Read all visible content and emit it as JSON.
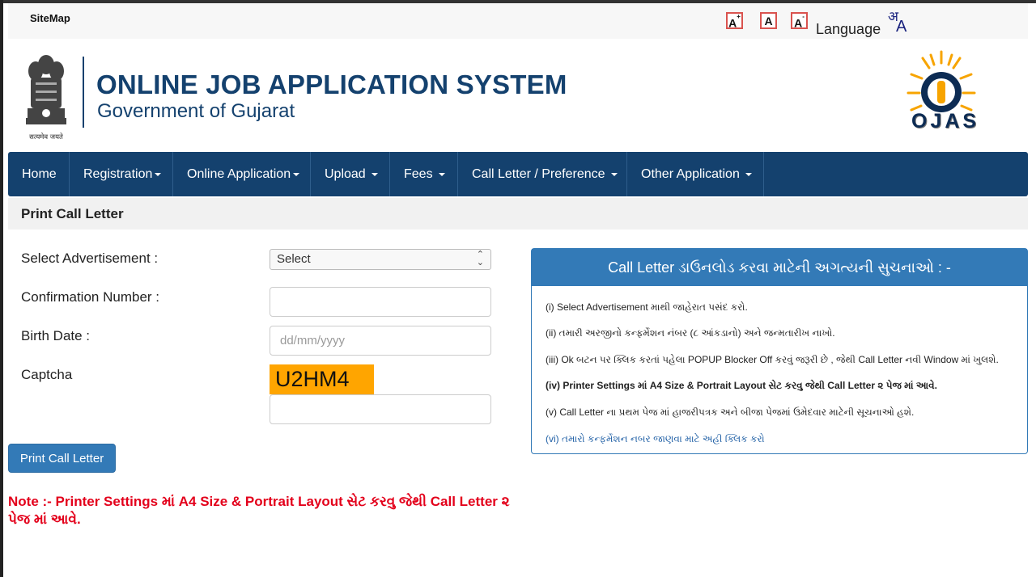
{
  "topbar": {
    "sitemap": "SiteMap",
    "font_increase": "A",
    "font_increase_sup": "+",
    "font_normal": "A",
    "font_decrease": "A",
    "font_decrease_sup": "-",
    "language": "Language",
    "language_icon_deva": "अ",
    "language_icon_latin": "A"
  },
  "header": {
    "emblem_caption": "सत्यमेव जयते",
    "title": "ONLINE JOB APPLICATION SYSTEM",
    "subtitle": "Government of Gujarat",
    "logo_text": "OJAS"
  },
  "nav": {
    "items": [
      {
        "label": "Home",
        "dropdown": false
      },
      {
        "label": "Registration",
        "dropdown": true
      },
      {
        "label": "Online Application",
        "dropdown": true
      },
      {
        "label": "Upload",
        "dropdown": true
      },
      {
        "label": "Fees",
        "dropdown": true
      },
      {
        "label": "Call Letter / Preference",
        "dropdown": true
      },
      {
        "label": "Other Application",
        "dropdown": true
      }
    ]
  },
  "page": {
    "title": "Print Call Letter"
  },
  "form": {
    "advertisement_label": "Select Advertisement :",
    "advertisement_value": "Select",
    "confirmation_label": "Confirmation Number :",
    "confirmation_value": "",
    "birthdate_label": "Birth Date :",
    "birthdate_placeholder": "dd/mm/yyyy",
    "captcha_label": "Captcha",
    "captcha_text": "U2HM4",
    "captcha_value": "",
    "submit_label": "Print Call Letter"
  },
  "note": "Note :- Printer Settings માં A4 Size & Portrait Layout સેટ કરવુ જેથી Call Letter ૨ પેજ માં આવે.",
  "instructions": {
    "title": "Call Letter ડાઉનલોડ કરવા માટેની અગત્યની સુચનાઓ : -",
    "items": [
      "(i) Select Advertisement માથી જાહેરાત પસંદ કરો.",
      "(ii) તમારી અરજીનો કન્ફર્મેશન નંબર (૮ આંકડાનો) અને જન્મતારીખ નાખો.",
      "(iii) Ok બટન પર ક્લિક કરતાં પહેલા POPUP Blocker Off કરવું જરૂરી છે , જેથી Call Letter નવી Window માં ખુલશે.",
      "(iv) Printer Settings માં A4 Size & Portrait Layout સેટ કરવુ જેથી Call Letter ૨ પેજ માં આવે.",
      "(v) Call Letter ના પ્રથમ પેજ માં હાજરીપત્રક અને બીજા પેજમાં ઉમેદવાર માટેની સૂચનાઓ હશે.",
      "(vi) તમારો કન્ફર્મેશન નબર જાણવા માટે અહી ક્લિક કરો"
    ]
  },
  "colors": {
    "primary_navy": "#14416e",
    "panel_blue": "#337ab7",
    "note_red": "#e3001b",
    "captcha_bg": "#ffa500"
  }
}
